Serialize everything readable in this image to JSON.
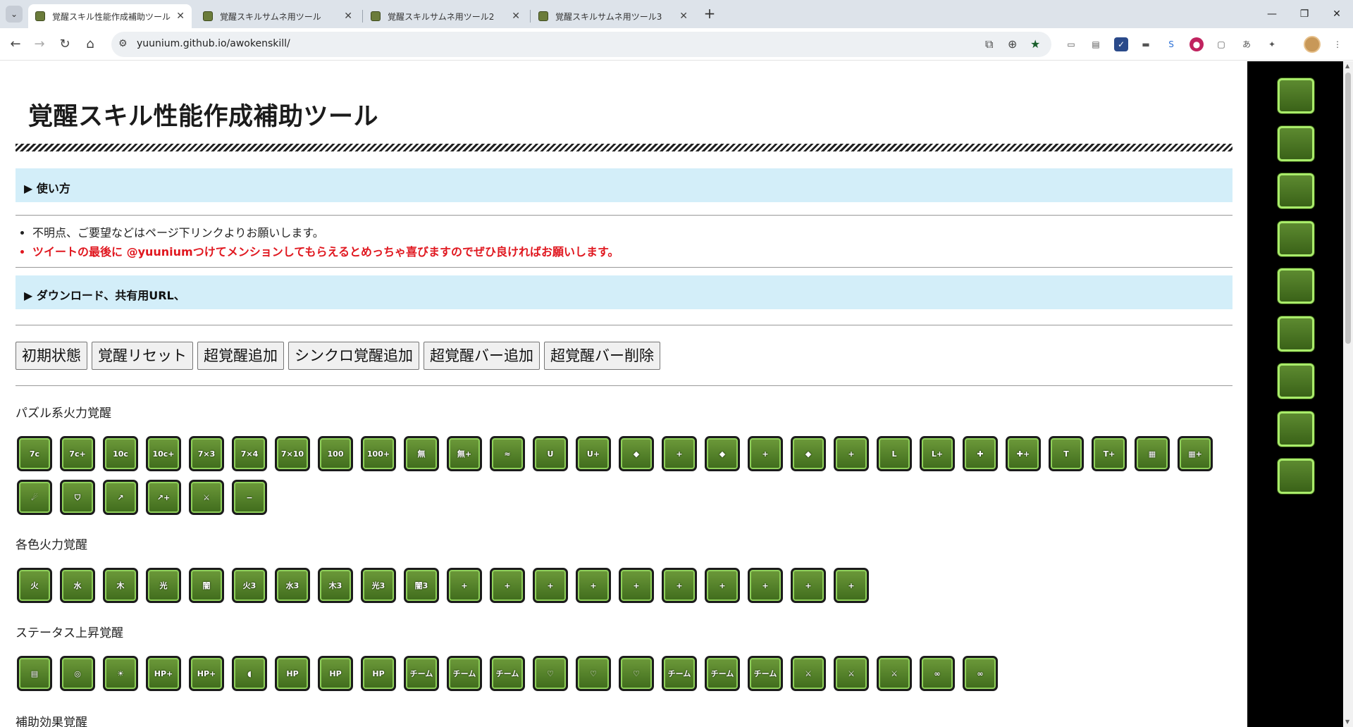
{
  "browser": {
    "tabs": [
      {
        "title": "覚醒スキル性能作成補助ツール",
        "active": true
      },
      {
        "title": "覚醒スキルサムネ用ツール",
        "active": false
      },
      {
        "title": "覚醒スキルサムネ用ツール2",
        "active": false
      },
      {
        "title": "覚醒スキルサムネ用ツール3",
        "active": false
      }
    ],
    "url": "yuunium.github.io/awokenskill/"
  },
  "page": {
    "title": "覚醒スキル性能作成補助ツール",
    "details_usage": "▶ 使い方",
    "notes": [
      "不明点、ご要望などはページ下リンクよりお願いします。",
      "ツイートの最後に @yuuniumつけてメンションしてもらえるとめっちゃ喜びますのでぜひ良ければお願いします。"
    ],
    "details_download": "▶ ダウンロード、共有用URL、",
    "buttons": [
      "初期状態",
      "覚醒リセット",
      "超覚醒追加",
      "シンクロ覚醒追加",
      "超覚醒バー追加",
      "超覚醒バー削除"
    ],
    "sections": [
      {
        "label": "パズル系火力覚醒",
        "icons": [
          {
            "name": "7combo-icon",
            "glyph": "7c"
          },
          {
            "name": "7combo-plus-icon",
            "glyph": "7c+"
          },
          {
            "name": "10combo-icon",
            "glyph": "10c"
          },
          {
            "name": "10combo-plus-icon",
            "glyph": "10c+"
          },
          {
            "name": "7combo-x3-icon",
            "glyph": "7×3"
          },
          {
            "name": "7combo-x4-icon",
            "glyph": "7×4"
          },
          {
            "name": "7combo-x10-icon",
            "glyph": "7×10"
          },
          {
            "name": "100combo-icon",
            "glyph": "100"
          },
          {
            "name": "100combo-plus-icon",
            "glyph": "100+"
          },
          {
            "name": "no-skyfall-icon",
            "glyph": "無"
          },
          {
            "name": "no-skyfall-plus-icon",
            "glyph": "無+"
          },
          {
            "name": "tpa-guard-icon",
            "glyph": "≈"
          },
          {
            "name": "u-shape-icon",
            "glyph": "U"
          },
          {
            "name": "u-shape-plus-icon",
            "glyph": "U+"
          },
          {
            "name": "three-orb-icon",
            "glyph": "◆"
          },
          {
            "name": "three-orb-plus-icon",
            "glyph": "+"
          },
          {
            "name": "four-orb-icon",
            "glyph": "◆"
          },
          {
            "name": "four-orb-plus-icon",
            "glyph": "+"
          },
          {
            "name": "five-orb-icon",
            "glyph": "◆"
          },
          {
            "name": "five-orb-plus-icon",
            "glyph": "+"
          },
          {
            "name": "l-shape-lock-icon",
            "glyph": "L"
          },
          {
            "name": "l-shape-plus-icon",
            "glyph": "L+"
          },
          {
            "name": "cross-icon",
            "glyph": "✚"
          },
          {
            "name": "cross-plus-icon",
            "glyph": "✚+"
          },
          {
            "name": "t-shape-icon",
            "glyph": "T"
          },
          {
            "name": "t-shape-plus-icon",
            "glyph": "T+"
          },
          {
            "name": "rainbow-icon",
            "glyph": "▦"
          },
          {
            "name": "rainbow-plus-icon",
            "glyph": "▦+"
          },
          {
            "name": "orb-burst-icon",
            "glyph": "☄"
          },
          {
            "name": "guard-break-icon",
            "glyph": "⛉"
          },
          {
            "name": "pink-slash-icon",
            "glyph": "↗"
          },
          {
            "name": "pink-slash-plus-icon",
            "glyph": "↗+"
          },
          {
            "name": "sword-bar-icon",
            "glyph": "⚔"
          },
          {
            "name": "sword-bar-minus-icon",
            "glyph": "−"
          }
        ]
      },
      {
        "label": "各色火力覚醒",
        "icons": [
          {
            "name": "fire-icon",
            "glyph": "火"
          },
          {
            "name": "water-icon",
            "glyph": "水"
          },
          {
            "name": "wood-icon",
            "glyph": "木"
          },
          {
            "name": "light-icon",
            "glyph": "光"
          },
          {
            "name": "dark-icon",
            "glyph": "闇"
          },
          {
            "name": "fire-x3-icon",
            "glyph": "火3"
          },
          {
            "name": "water-x3-icon",
            "glyph": "水3"
          },
          {
            "name": "wood-x3-icon",
            "glyph": "木3"
          },
          {
            "name": "light-x3-icon",
            "glyph": "光3"
          },
          {
            "name": "dark-x3-icon",
            "glyph": "闇3"
          },
          {
            "name": "fire-row-plus-icon",
            "glyph": "+"
          },
          {
            "name": "water-row-plus-icon",
            "glyph": "+"
          },
          {
            "name": "wood-row-plus-icon",
            "glyph": "+"
          },
          {
            "name": "light-row-plus-icon",
            "glyph": "+"
          },
          {
            "name": "dark-row-plus-icon",
            "glyph": "+"
          },
          {
            "name": "fire-row-orange-plus-icon",
            "glyph": "+"
          },
          {
            "name": "water-row-orange-plus-icon",
            "glyph": "+"
          },
          {
            "name": "wood-row-orange-plus-icon",
            "glyph": "+"
          },
          {
            "name": "light-row-orange-plus-icon",
            "glyph": "+"
          },
          {
            "name": "dark-row-orange-plus-icon",
            "glyph": "+"
          }
        ]
      },
      {
        "label": "ステータス上昇覚醒",
        "icons": [
          {
            "name": "barrel-icon",
            "glyph": "▤"
          },
          {
            "name": "swirl-icon",
            "glyph": "◎"
          },
          {
            "name": "sun-icon",
            "glyph": "☀"
          },
          {
            "name": "sword-hp-plus-icon",
            "glyph": "HP+"
          },
          {
            "name": "sword-hp-plus2-icon",
            "glyph": "HP+"
          },
          {
            "name": "voice-icon",
            "glyph": "◖"
          },
          {
            "name": "hp-plus-icon",
            "glyph": "HP"
          },
          {
            "name": "hp-orange-plus-icon",
            "glyph": "HP"
          },
          {
            "name": "hp-minus-icon",
            "glyph": "HP"
          },
          {
            "name": "team-plus-icon",
            "glyph": "チーム"
          },
          {
            "name": "team-orange-plus-icon",
            "glyph": "チーム"
          },
          {
            "name": "team-minus-icon",
            "glyph": "チーム"
          },
          {
            "name": "heart-plus-icon",
            "glyph": "♡"
          },
          {
            "name": "heart-orange-plus-icon",
            "glyph": "♡"
          },
          {
            "name": "heart-minus-icon",
            "glyph": "♡"
          },
          {
            "name": "team-heart-plus-icon",
            "glyph": "チーム"
          },
          {
            "name": "team-heart-orange-plus-icon",
            "glyph": "チーム"
          },
          {
            "name": "team-heart-minus-icon",
            "glyph": "チーム"
          },
          {
            "name": "boot-plus-icon",
            "glyph": "⚔"
          },
          {
            "name": "boot-orange-plus-icon",
            "glyph": "⚔"
          },
          {
            "name": "boot-minus-icon",
            "glyph": "⚔"
          },
          {
            "name": "wing-plus-icon",
            "glyph": "∞"
          },
          {
            "name": "wing-orange-plus-icon",
            "glyph": "∞"
          }
        ]
      },
      {
        "label": "補助効果覚醒",
        "icons": []
      }
    ]
  },
  "sidepanel": {
    "slots": 9
  }
}
